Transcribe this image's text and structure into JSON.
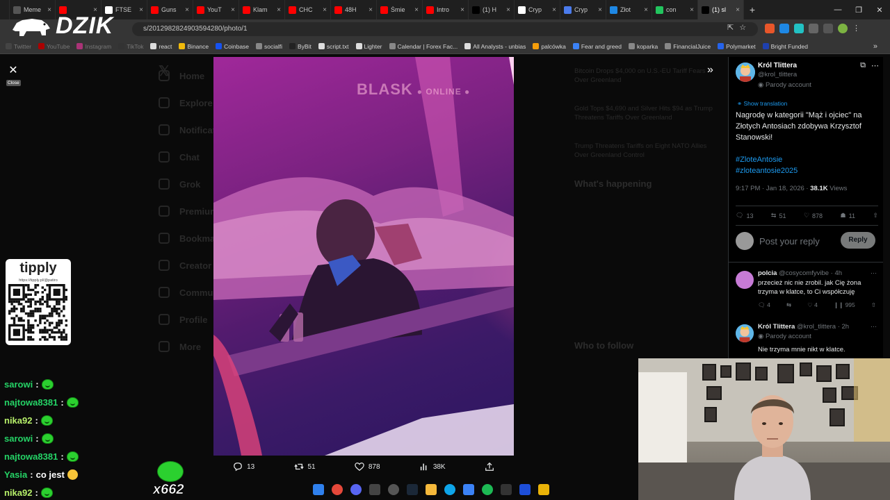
{
  "browser": {
    "tabs": [
      {
        "label": "Meme",
        "color": "#555555"
      },
      {
        "label": "",
        "color": "#ff0000"
      },
      {
        "label": "FTSE",
        "color": "#ffffff"
      },
      {
        "label": "Guns",
        "color": "#ff0000"
      },
      {
        "label": "YouT",
        "color": "#ff0000"
      },
      {
        "label": "Klam",
        "color": "#ff0000"
      },
      {
        "label": "CHC",
        "color": "#ff0000"
      },
      {
        "label": "48H",
        "color": "#ff0000"
      },
      {
        "label": "Śmie",
        "color": "#ff0000"
      },
      {
        "label": "Intro",
        "color": "#ff0000"
      },
      {
        "label": "(1) H",
        "color": "#000000"
      },
      {
        "label": "Cryp",
        "color": "#ffffff"
      },
      {
        "label": "Cryp",
        "color": "#4b7bec"
      },
      {
        "label": "Złot",
        "color": "#1e88e5"
      },
      {
        "label": "con",
        "color": "#22c55e"
      },
      {
        "label": "(1) sl",
        "color": "#000000"
      }
    ],
    "url": "s/2012982824903594280/photo/1",
    "bookmarks": [
      {
        "label": "Twitter",
        "color": "#444444",
        "dim": true
      },
      {
        "label": "YouTube",
        "color": "#aa0000",
        "dim": true
      },
      {
        "label": "Instagram",
        "color": "#aa3377",
        "dim": true
      },
      {
        "label": "TikTok",
        "color": "#333333",
        "dim": true
      },
      {
        "label": "react",
        "color": "#dddddd",
        "dim": false
      },
      {
        "label": "Binance",
        "color": "#f0b90b",
        "dim": false
      },
      {
        "label": "Coinbase",
        "color": "#1652f0",
        "dim": false
      },
      {
        "label": "socialfi",
        "color": "#888888",
        "dim": false
      },
      {
        "label": "ByBit",
        "color": "#222222",
        "dim": false
      },
      {
        "label": "script.txt",
        "color": "#dddddd",
        "dim": false
      },
      {
        "label": "Lighter",
        "color": "#dddddd",
        "dim": false
      },
      {
        "label": "Calendar | Forex Fac...",
        "color": "#888888",
        "dim": false
      },
      {
        "label": "All Analysts - unbias",
        "color": "#dddddd",
        "dim": false
      },
      {
        "label": "palcówka",
        "color": "#f59e0b",
        "dim": false
      },
      {
        "label": "Fear and greed",
        "color": "#3b82f6",
        "dim": false
      },
      {
        "label": "koparka",
        "color": "#888888",
        "dim": false
      },
      {
        "label": "FinancialJuice",
        "color": "#888888",
        "dim": false
      },
      {
        "label": "Polymarket",
        "color": "#2563eb",
        "dim": false
      },
      {
        "label": "Bright Funded",
        "color": "#1e40af",
        "dim": false
      }
    ]
  },
  "overlay": {
    "brand": "DZIK",
    "close_tip": "Close",
    "tipply_title": "tipply",
    "tipply_url": "https://tipply.pl/@patiro",
    "combo": "x662"
  },
  "twitter_bg": {
    "nav": [
      "Home",
      "Explore",
      "Notifications",
      "Chat",
      "Grok",
      "Premium",
      "Bookmarks",
      "Creator Studio",
      "Communities",
      "Profile",
      "More"
    ],
    "news": [
      "Bitcoin Drops $4,000 on U.S.-EU Tariff Fears Over Greenland",
      "Gold Tops $4,690 and Silver Hits $94 as Trump Threatens Tariffs Over Greenland",
      "Trump Threatens Tariffs on Eight NATO Allies Over Greenland Control"
    ],
    "happening": "What's happening",
    "follow": "Who to follow"
  },
  "photo": {
    "watermark": "BLASK",
    "watermark_sub": "ONLINE",
    "actions": {
      "replies": "13",
      "reposts": "51",
      "likes": "878",
      "views": "38K"
    }
  },
  "tweet": {
    "author_name": "Król Tlittera",
    "author_handle": "@krol_tlittera",
    "parody": "Parody account",
    "show_translation": "Show translation",
    "text": "Nagrodę w kategorii \"Mąż i ojciec\" na Złotych Antosiach zdobywa Krzysztof Stanowski!",
    "tag1": "#ZloteAntosie",
    "tag2": "#zloteantosie2025",
    "time": "9:17 PM · Jan 18, 2026 · ",
    "views_count": "38.1K",
    "views_label": " Views",
    "stats": {
      "replies": "13",
      "reposts": "51",
      "likes": "878",
      "bookmarks": "11"
    },
    "reply_placeholder": "Post your reply",
    "reply_button": "Reply"
  },
  "replies": [
    {
      "name": "polcia",
      "handle": "@cosycomfyvibe · 4h",
      "text": "przecież nic nie zrobil. jak Cię żona trzyma w klatce, to Ci współczuję",
      "replies": "4",
      "likes": "4",
      "views": "995"
    },
    {
      "name": "Król Tlittera",
      "handle": "@krol_tlittera · 2h",
      "parody": "Parody account",
      "text": "Nie trzyma mnie nikt w klatce."
    }
  ],
  "chat": [
    {
      "user": "sarowi",
      "msg": "",
      "emote": "green",
      "purple": false
    },
    {
      "user": "najtowa8381",
      "msg": "",
      "emote": "green",
      "purple": false
    },
    {
      "user": "nika92",
      "msg": "",
      "emote": "green",
      "purple": true
    },
    {
      "user": "sarowi",
      "msg": "",
      "emote": "green",
      "purple": false
    },
    {
      "user": "najtowa8381",
      "msg": "",
      "emote": "green",
      "purple": false
    },
    {
      "user": "Yasia",
      "msg": "co jest",
      "emote": "laugh",
      "purple": false
    },
    {
      "user": "nika92",
      "msg": "",
      "emote": "green",
      "purple": true
    }
  ]
}
